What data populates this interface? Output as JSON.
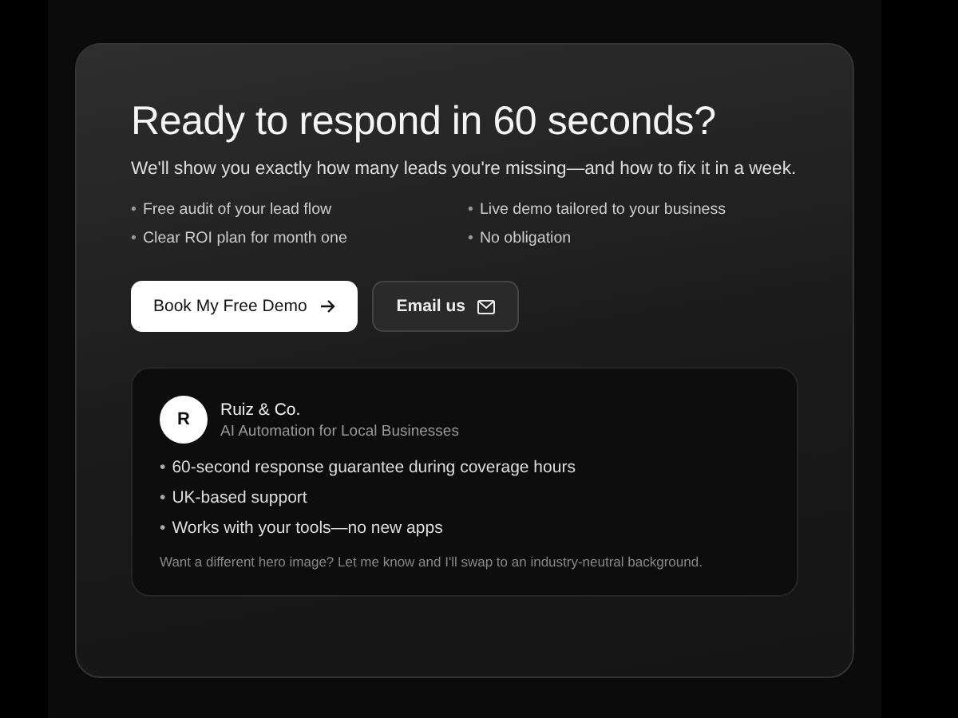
{
  "cta": {
    "title": "Ready to respond in 60 seconds?",
    "subtitle": "We'll show you exactly how many leads you're missing—and how to fix it in a week.",
    "bullet": "•",
    "benefits": [
      "Free audit of your lead flow",
      "Live demo tailored to your business",
      "Clear ROI plan for month one",
      "No obligation"
    ],
    "buttons": [
      {
        "label": "Book My Free Demo",
        "kind": "primary"
      },
      {
        "label": "Email us",
        "kind": "secondary"
      }
    ]
  },
  "company_card": {
    "avatar": "R",
    "name": "Ruiz & Co.",
    "tagline": "AI Automation for Local Businesses",
    "points": [
      "60-second response guarantee during coverage hours",
      "UK-based support",
      "Works with your tools—no new apps"
    ],
    "note": "Want a different hero image? Let me know and I'll swap to an industry-neutral background."
  }
}
